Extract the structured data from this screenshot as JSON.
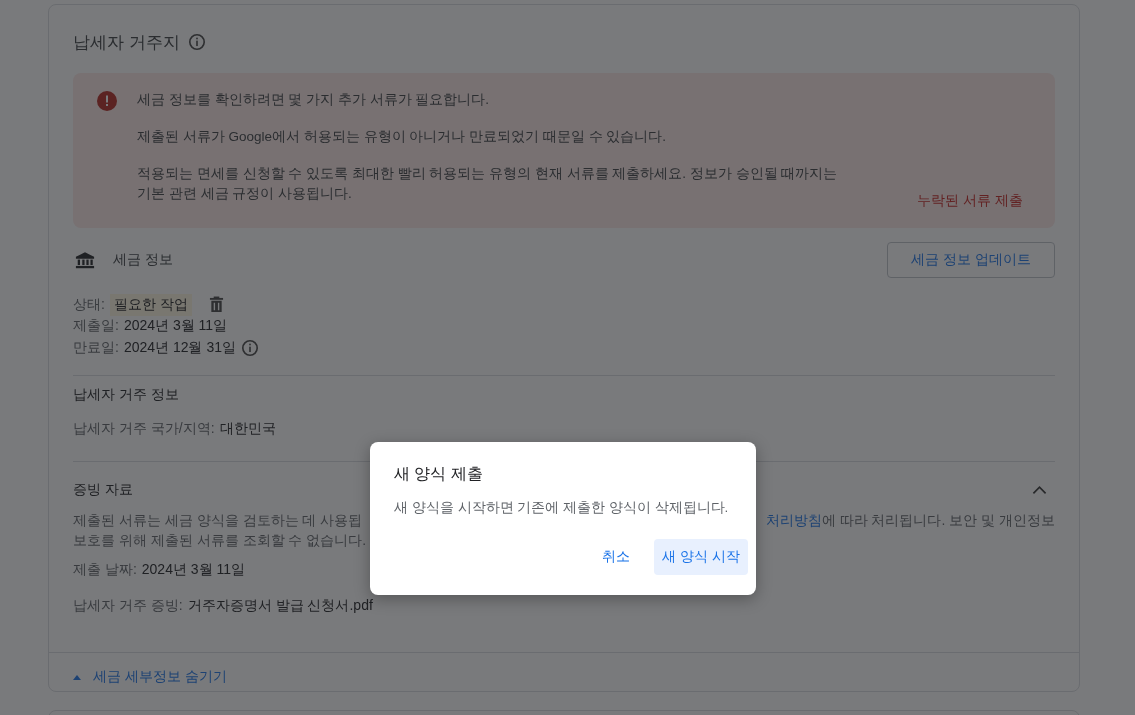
{
  "section": {
    "title": "납세자 거주지"
  },
  "alert": {
    "paragraphs": [
      [
        "세금 정보를 확인하려면 몇 가지 추가 서류가 필요합니다."
      ],
      [
        "제출된 서류가 Google에서 허용되는 유형이 아니거나 만료되었기 때문일 수 있습니다."
      ],
      [
        "적용되는 면세를 신청할 수 있도록 최대한 빨리 허용되는 유형의 현재 서류를 제출하세요. 정보가 승인될 때까지는",
        "기본 관련 세금 규정이 사용됩니다."
      ]
    ],
    "action": "누락된 서류 제출"
  },
  "tax_info": {
    "title": "세금 정보",
    "update_button": "세금 정보 업데이트",
    "fields": [
      {
        "label": "상태:",
        "value": "필요한 작업",
        "kind": "status"
      },
      {
        "label": "제출일:",
        "value": "2024년 3월 11일",
        "kind": "plain"
      },
      {
        "label": "만료일:",
        "value": "2024년 12월 31일",
        "kind": "info"
      }
    ]
  },
  "residency": {
    "title": "납세자 거주 정보",
    "fields": [
      {
        "label": "납세자 거주 국가/지역:",
        "value": "대한민국"
      }
    ]
  },
  "documents": {
    "title": "증빙 자료",
    "expanded": true,
    "note_left": "제출된 서류는 세금 양식을 검토하는 데 사용됩",
    "note_link": "처리방침",
    "note_right": "에 따라 처리됩니다. 보안 및 개인정보",
    "note_line2": "보호를 위해 제출된 서류를 조회할 수 없습니다.",
    "fields": [
      {
        "label": "제출 날짜:",
        "value": "2024년 3월 11일"
      },
      {
        "label": "납세자 거주 증빙:",
        "value": "거주자증명서 발급 신청서.pdf"
      }
    ]
  },
  "toggle": {
    "label": "세금 세부정보 숨기기",
    "expanded": true
  },
  "dialog": {
    "title": "새 양식 제출",
    "message": "새 양식을 시작하면 기존에 제출한 양식이 삭제됩니다.",
    "buttons": [
      {
        "label": "취소",
        "kind": "text"
      },
      {
        "label": "새 양식 시작",
        "kind": "tonal"
      }
    ]
  }
}
